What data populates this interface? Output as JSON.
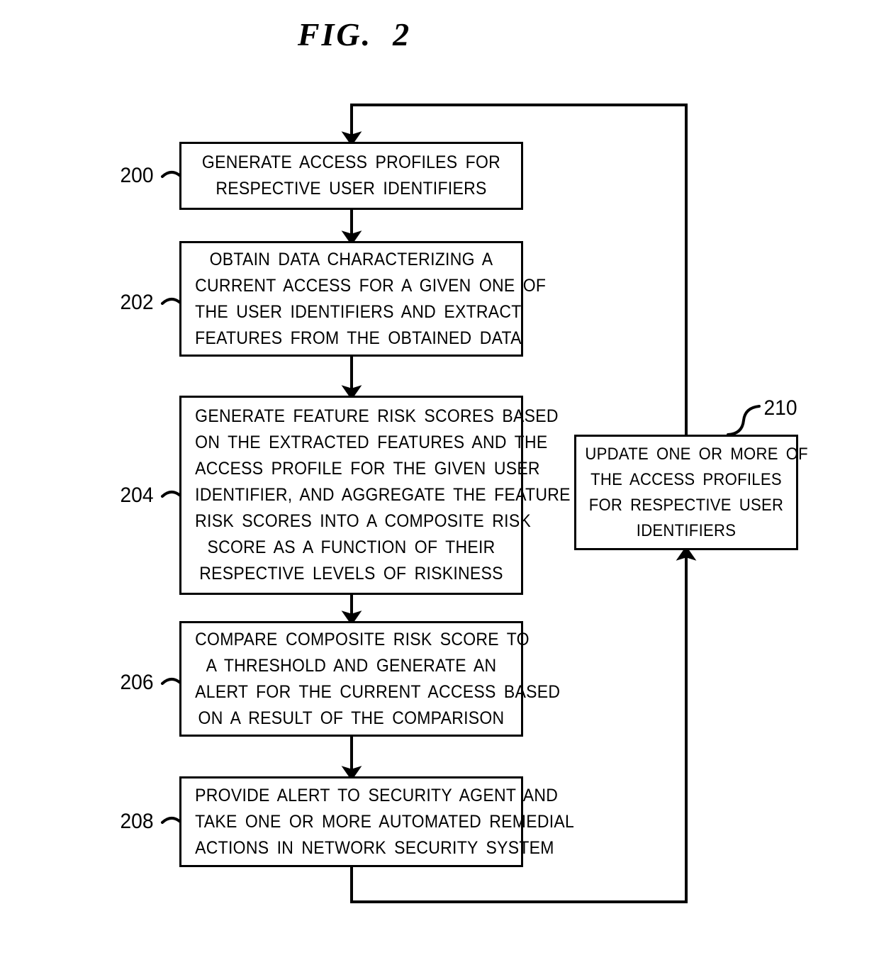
{
  "figure": {
    "title": "FIG.  2"
  },
  "flowchart": {
    "steps": [
      {
        "ref": "200",
        "lines": [
          "GENERATE ACCESS PROFILES FOR",
          "RESPECTIVE USER IDENTIFIERS"
        ]
      },
      {
        "ref": "202",
        "lines": [
          "OBTAIN DATA CHARACTERIZING A",
          "CURRENT ACCESS FOR A GIVEN ONE OF",
          "THE USER IDENTIFIERS AND EXTRACT",
          "FEATURES FROM THE OBTAINED DATA"
        ]
      },
      {
        "ref": "204",
        "lines": [
          "GENERATE FEATURE RISK SCORES BASED",
          "ON THE EXTRACTED FEATURES AND THE",
          "ACCESS PROFILE FOR THE GIVEN USER",
          "IDENTIFIER, AND AGGREGATE THE FEATURE",
          "RISK SCORES INTO A COMPOSITE RISK",
          "SCORE AS A FUNCTION OF THEIR",
          "RESPECTIVE LEVELS OF RISKINESS"
        ]
      },
      {
        "ref": "206",
        "lines": [
          "COMPARE COMPOSITE RISK SCORE TO",
          "A THRESHOLD AND GENERATE AN",
          "ALERT FOR THE CURRENT ACCESS BASED",
          "ON A RESULT OF THE COMPARISON"
        ]
      },
      {
        "ref": "208",
        "lines": [
          "PROVIDE ALERT TO SECURITY AGENT AND",
          "TAKE ONE OR MORE AUTOMATED REMEDIAL",
          "ACTIONS IN NETWORK SECURITY SYSTEM"
        ]
      },
      {
        "ref": "210",
        "lines": [
          "UPDATE ONE OR MORE OF",
          "THE ACCESS PROFILES",
          "FOR RESPECTIVE USER",
          "IDENTIFIERS"
        ]
      }
    ]
  },
  "style": {
    "ink": "#000000",
    "paper": "#ffffff"
  }
}
